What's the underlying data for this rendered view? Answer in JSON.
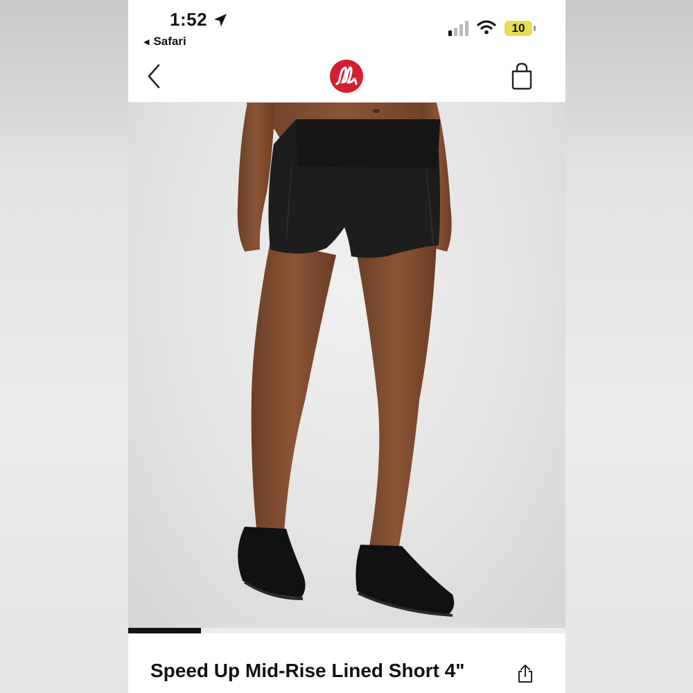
{
  "status_bar": {
    "time": "1:52",
    "back_app": "Safari",
    "battery": "10",
    "icons": [
      "location-arrow-icon",
      "signal-bars-icon",
      "wifi-icon",
      "battery-icon"
    ],
    "battery_color": "#e7dc54"
  },
  "nav": {
    "back_icon": "chevron-left-icon",
    "logo_icon": "lululemon-logo",
    "bag_icon": "shopping-bag-icon",
    "brand_color": "#d31f2f"
  },
  "product": {
    "image_alt": "product-photo",
    "carousel_progress": 0.167,
    "title": "Speed Up Mid-Rise Lined Short 4\"",
    "share_icon": "share-icon"
  }
}
